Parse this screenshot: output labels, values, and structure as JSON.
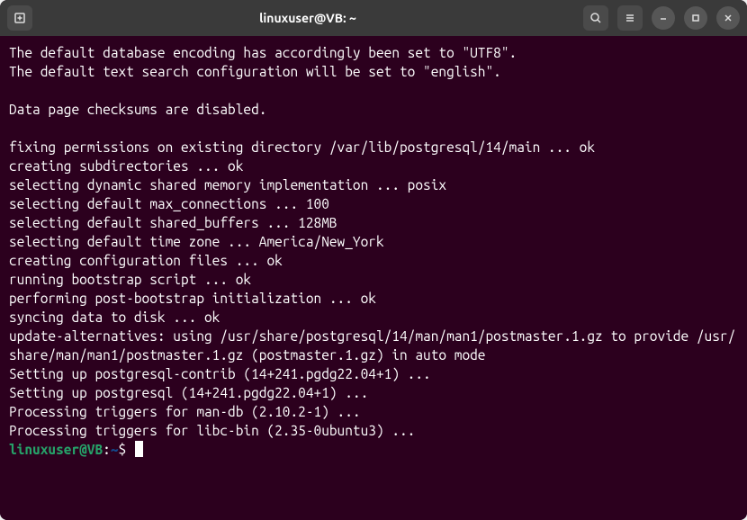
{
  "titlebar": {
    "title": "linuxuser@VB: ~"
  },
  "terminal": {
    "lines": [
      "The default database encoding has accordingly been set to \"UTF8\".",
      "The default text search configuration will be set to \"english\".",
      "",
      "Data page checksums are disabled.",
      "",
      "fixing permissions on existing directory /var/lib/postgresql/14/main ... ok",
      "creating subdirectories ... ok",
      "selecting dynamic shared memory implementation ... posix",
      "selecting default max_connections ... 100",
      "selecting default shared_buffers ... 128MB",
      "selecting default time zone ... America/New_York",
      "creating configuration files ... ok",
      "running bootstrap script ... ok",
      "performing post-bootstrap initialization ... ok",
      "syncing data to disk ... ok",
      "update-alternatives: using /usr/share/postgresql/14/man/man1/postmaster.1.gz to provide /usr/share/man/man1/postmaster.1.gz (postmaster.1.gz) in auto mode",
      "Setting up postgresql-contrib (14+241.pgdg22.04+1) ...",
      "Setting up postgresql (14+241.pgdg22.04+1) ...",
      "Processing triggers for man-db (2.10.2-1) ...",
      "Processing triggers for libc-bin (2.35-0ubuntu3) ..."
    ],
    "prompt": {
      "user_host": "linuxuser@VB",
      "sep1": ":",
      "path": "~",
      "sep2": "$ "
    }
  }
}
